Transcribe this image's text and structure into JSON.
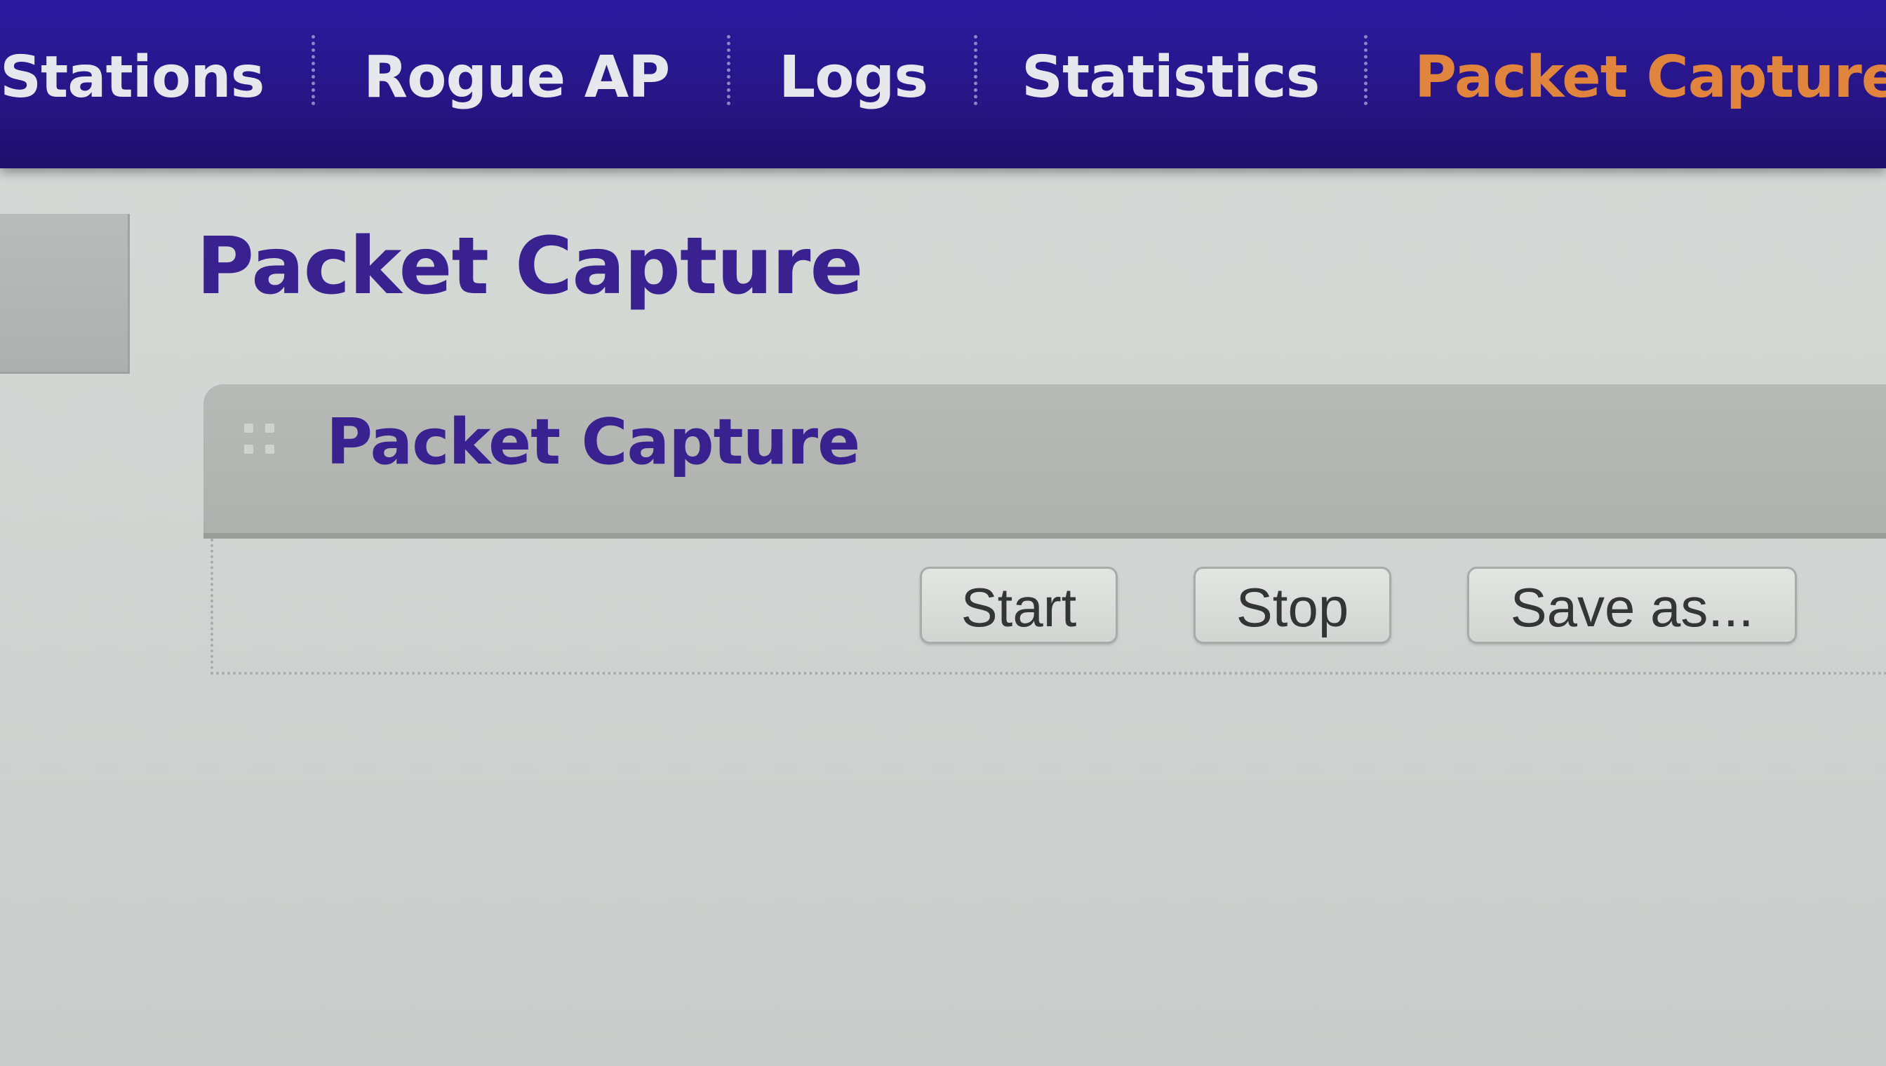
{
  "nav": {
    "items": [
      {
        "label": "Stations",
        "active": false
      },
      {
        "label": "Rogue AP",
        "active": false
      },
      {
        "label": "Logs",
        "active": false
      },
      {
        "label": "Statistics",
        "active": false
      },
      {
        "label": "Packet Capture",
        "active": true
      }
    ],
    "active_color": "#e0843e",
    "bar_color": "#271585"
  },
  "page": {
    "title": "Packet Capture"
  },
  "panel": {
    "title": "Packet Capture",
    "handle_icon": "drag-handle-icon"
  },
  "actions": {
    "start_label": "Start",
    "stop_label": "Stop",
    "save_label": "Save as..."
  },
  "colors": {
    "title": "#3a2190",
    "background": "#d4d8d5"
  }
}
